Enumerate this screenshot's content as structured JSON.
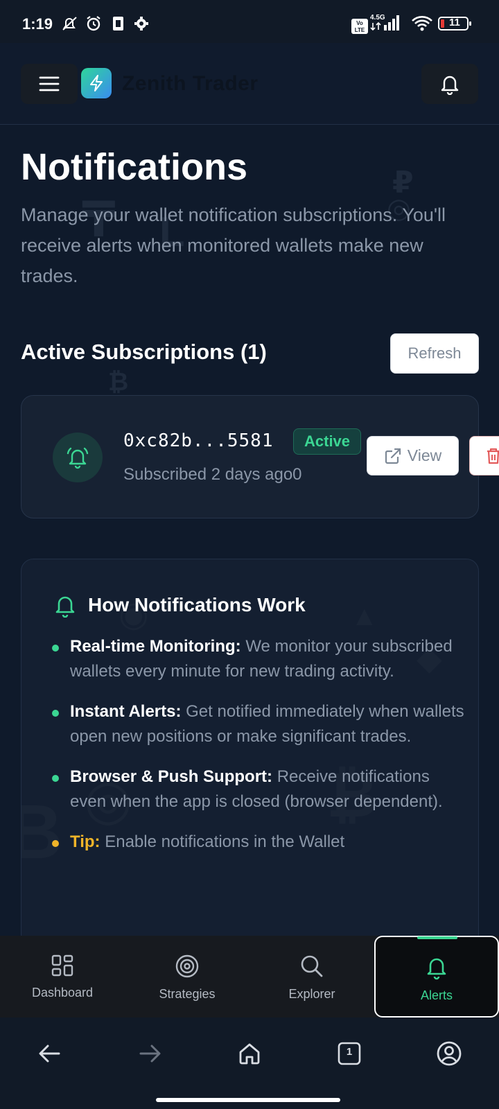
{
  "status_bar": {
    "time": "1:19",
    "network": "4.5G",
    "volte": "Vo LTE",
    "battery": "11"
  },
  "header": {
    "brand": "Zenith Trader",
    "icons": [
      "menu-icon",
      "lightning-icon",
      "bell-icon"
    ]
  },
  "page": {
    "title": "Notifications",
    "subtitle": "Manage your wallet notification subscriptions. You'll receive alerts when monitored wallets make new trades."
  },
  "subscriptions": {
    "heading": "Active Subscriptions (1)",
    "refresh_label": "Refresh",
    "items": [
      {
        "address": "0xc82b...5581",
        "status": "Active",
        "subscribed": "Subscribed 2 days ago0",
        "view_label": "View"
      }
    ]
  },
  "how_it_works": {
    "title": "How Notifications Work",
    "items": [
      {
        "label": "Real-time Monitoring:",
        "text": " We monitor your subscribed wallets every minute for new trading activity."
      },
      {
        "label": "Instant Alerts:",
        "text": " Get notified immediately when wallets open new positions or make significant trades."
      },
      {
        "label": "Browser & Push Support:",
        "text": " Receive notifications even when the app is closed (browser dependent)."
      },
      {
        "label": "Tip:",
        "text": " Enable notifications in the Wallet"
      }
    ]
  },
  "tabs": [
    {
      "label": "Dashboard",
      "icon": "grid-icon",
      "active": false
    },
    {
      "label": "Strategies",
      "icon": "target-icon",
      "active": false
    },
    {
      "label": "Explorer",
      "icon": "search-icon",
      "active": false
    },
    {
      "label": "Alerts",
      "icon": "bell-icon",
      "active": true
    }
  ],
  "system_nav": {
    "tab_count": "1"
  },
  "colors": {
    "accent": "#3bd693",
    "background": "#0f1a2b",
    "tip": "#f0b429"
  }
}
